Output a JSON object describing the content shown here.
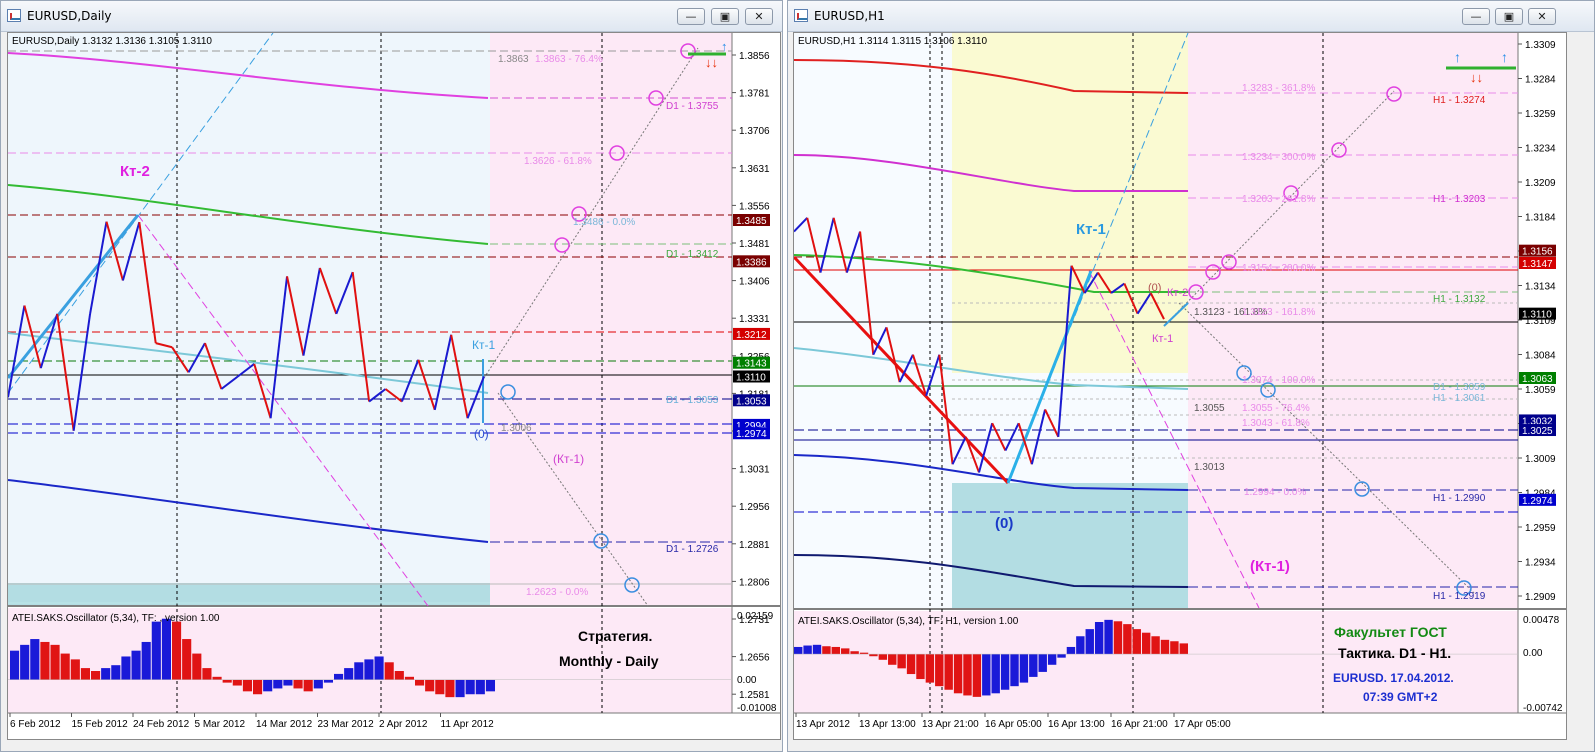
{
  "windows": {
    "left": {
      "title": "EURUSD,Daily",
      "quote": "EURUSD,Daily  1.3132 1.3136 1.3105 1.3110",
      "axis_labels": [
        "1.3856",
        "1.3781",
        "1.3706",
        "1.3631",
        "1.3556",
        "1.3481",
        "1.3406",
        "1.3331",
        "1.3256",
        "1.3181",
        "1.3106",
        "1.3031",
        "1.2956",
        "1.2881",
        "1.2806",
        "1.2731",
        "1.2656",
        "1.2581"
      ],
      "x_labels": [
        "6 Feb 2012",
        "15 Feb 2012",
        "24 Feb 2012",
        "5 Mar 2012",
        "14 Mar 2012",
        "23 Mar 2012",
        "2 Apr 2012",
        "11 Apr 2012"
      ],
      "price_tags": [
        {
          "text": "1.3485",
          "color": "#7a0000"
        },
        {
          "text": "1.3386",
          "color": "#7a0000"
        },
        {
          "text": "1.3212",
          "color": "#d40000"
        },
        {
          "text": "1.3143",
          "color": "#008000"
        },
        {
          "text": "1.3110",
          "color": "#000000"
        },
        {
          "text": "1.3053",
          "color": "#00008b"
        },
        {
          "text": "1.2994",
          "color": "#0000cd"
        },
        {
          "text": "1.2974",
          "color": "#0000cd"
        }
      ],
      "annotations": {
        "kt2": "Кт-2",
        "kt1": "Кт-1",
        "zero": "(0)",
        "kt1_paren": "(Кт-1)",
        "fib_3863": "1.3863",
        "fib_3863b": "1.3863 - 76.4%",
        "d1_3755": "D1 - 1.3755",
        "fib_3626": "1.3626 - 61.8%",
        "fib_3486": "1.3486 - 0.0%",
        "d1_3412": "D1 - 1.3412",
        "d1_3053": "D1 - 1.3053",
        "lbl_3006": "1.3006",
        "d1_2726": "D1 - 1.2726",
        "fib_2623": "1.2623 - 0.0%"
      },
      "oscillator": {
        "title": "ATEI.SAKS.Oscillator (5,34), TF: , version 1.00",
        "axis_labels": [
          "0.02159",
          "0.00",
          "-0.01008"
        ],
        "caption_line1": "Стратегия.",
        "caption_line2": "Monthly - Daily"
      }
    },
    "right": {
      "title": "EURUSD,H1",
      "quote": "EURUSD,H1  1.3114 1.3115 1.3106 1.3110",
      "axis_labels": [
        "1.3309",
        "1.3284",
        "1.3259",
        "1.3234",
        "1.3209",
        "1.3184",
        "1.3159",
        "1.3134",
        "1.3109",
        "1.3084",
        "1.3059",
        "1.3034",
        "1.3009",
        "1.2984",
        "1.2959",
        "1.2934",
        "1.2909"
      ],
      "x_labels": [
        "13 Apr 2012",
        "13 Apr 13:00",
        "13 Apr 21:00",
        "16 Apr 05:00",
        "16 Apr 13:00",
        "16 Apr 21:00",
        "17 Apr 05:00"
      ],
      "price_tags": [
        {
          "text": "1.3156",
          "color": "#7a0000"
        },
        {
          "text": "1.3147",
          "color": "#d40000"
        },
        {
          "text": "1.3110",
          "color": "#000000"
        },
        {
          "text": "1.3063",
          "color": "#008000"
        },
        {
          "text": "1.3032",
          "color": "#00008b"
        },
        {
          "text": "1.3025",
          "color": "#00008b"
        },
        {
          "text": "1.2974",
          "color": "#0000cd"
        }
      ],
      "annotations": {
        "kt1": "Кт-1",
        "zero": "(0)",
        "kt1_paren": "(Кт-1)",
        "zero_small": "(0)",
        "kt2_small": "Кт-2",
        "kt1_small": "Кт-1",
        "fib_3283": "1.3283 - 361.8%",
        "h1_3274": "H1 - 1.3274",
        "fib_3234": "1.3234 - 300.0%",
        "fib_3203": "1.3203 - 261.8%",
        "h1_3203": "H1 - 1.3203",
        "fib_3154": "1.3154 - 200.0%",
        "h1_3132": "H1 - 1.3132",
        "lbl_3123": "1.3123 - 161.8%",
        "fib_3123": "1.3123 - 161.8%",
        "fib_3074": "1.3074 - 100.0%",
        "h1_3059": "D1 - 1.3059",
        "h1_3061": "H1 - 1.3061",
        "lbl_3055": "1.3055",
        "fib_3055": "1.3055 - 76.4%",
        "fib_3043": "1.3043 - 61.8%",
        "lbl_3013": "1.3013",
        "fib_2994": "1.2994 - 0.0%",
        "h1_2990": "H1 - 1.2990",
        "h1_2919": "H1 - 1.2919"
      },
      "oscillator": {
        "title": "ATEI.SAKS.Oscillator (5,34), TF: H1, version 1.00",
        "axis_labels": [
          "0.00478",
          "0.00",
          "-0.00742"
        ],
        "caption_line1": "Факультет ГОСТ",
        "caption_line2": "Тактика. D1 - H1.",
        "caption_line3": "EURUSD. 17.04.2012.",
        "caption_line4": "07:39  GMT+2"
      }
    }
  },
  "chart_data": [
    {
      "type": "line",
      "title": "EURUSD,Daily",
      "ylim": [
        1.256,
        1.389
      ],
      "series": [
        {
          "values": [
            1.306,
            1.328,
            1.313,
            1.326,
            1.298,
            1.326,
            1.3481,
            1.334,
            1.348,
            1.319,
            1.318,
            1.312,
            1.319,
            1.308,
            1.311,
            1.314,
            1.301,
            1.335,
            1.316,
            1.337,
            1.326,
            1.336,
            1.305,
            1.308,
            1.305,
            1.315,
            1.303,
            1.321,
            1.301,
            1.311
          ]
        }
      ],
      "oscillator": {
        "ylim": [
          -0.01008,
          0.02159
        ],
        "values": [
          0.01,
          0.012,
          0.014,
          0.013,
          0.012,
          0.009,
          0.007,
          0.004,
          0.003,
          0.004,
          0.005,
          0.008,
          0.01,
          0.013,
          0.02,
          0.021,
          0.02,
          0.014,
          0.009,
          0.004,
          0.001,
          -0.001,
          -0.002,
          -0.004,
          -0.005,
          -0.004,
          -0.003,
          -0.002,
          -0.003,
          -0.004,
          -0.003,
          -0.001,
          0.002,
          0.004,
          0.006,
          0.007,
          0.008,
          0.006,
          0.003,
          0.001,
          -0.002,
          -0.004,
          -0.005,
          -0.006,
          -0.006,
          -0.005,
          -0.005,
          -0.004
        ]
      }
    },
    {
      "type": "line",
      "title": "EURUSD,H1",
      "ylim": [
        1.2895,
        1.3315
      ],
      "series": [
        {
          "values": [
            1.317,
            1.318,
            1.314,
            1.318,
            1.314,
            1.317,
            1.308,
            1.31,
            1.306,
            1.308,
            1.305,
            1.308,
            1.3,
            1.302,
            1.2994,
            1.303,
            1.301,
            1.303,
            1.3,
            1.304,
            1.302,
            1.3145,
            1.3125,
            1.314,
            1.3125,
            1.3132,
            1.311,
            1.3125,
            1.3106
          ]
        }
      ],
      "oscillator": {
        "ylim": [
          -0.00742,
          0.00478
        ],
        "values": [
          0.001,
          0.0012,
          0.0013,
          0.0011,
          0.001,
          0.0008,
          0.0004,
          0.0002,
          -0.0003,
          -0.0008,
          -0.0015,
          -0.002,
          -0.0028,
          -0.0035,
          -0.004,
          -0.0045,
          -0.005,
          -0.0055,
          -0.0058,
          -0.006,
          -0.0058,
          -0.0055,
          -0.005,
          -0.0045,
          -0.004,
          -0.0032,
          -0.0025,
          -0.0015,
          -0.0005,
          0.001,
          0.0025,
          0.0035,
          0.0045,
          0.0048,
          0.0046,
          0.0042,
          0.0035,
          0.003,
          0.0025,
          0.002,
          0.0018,
          0.0015
        ]
      }
    }
  ]
}
